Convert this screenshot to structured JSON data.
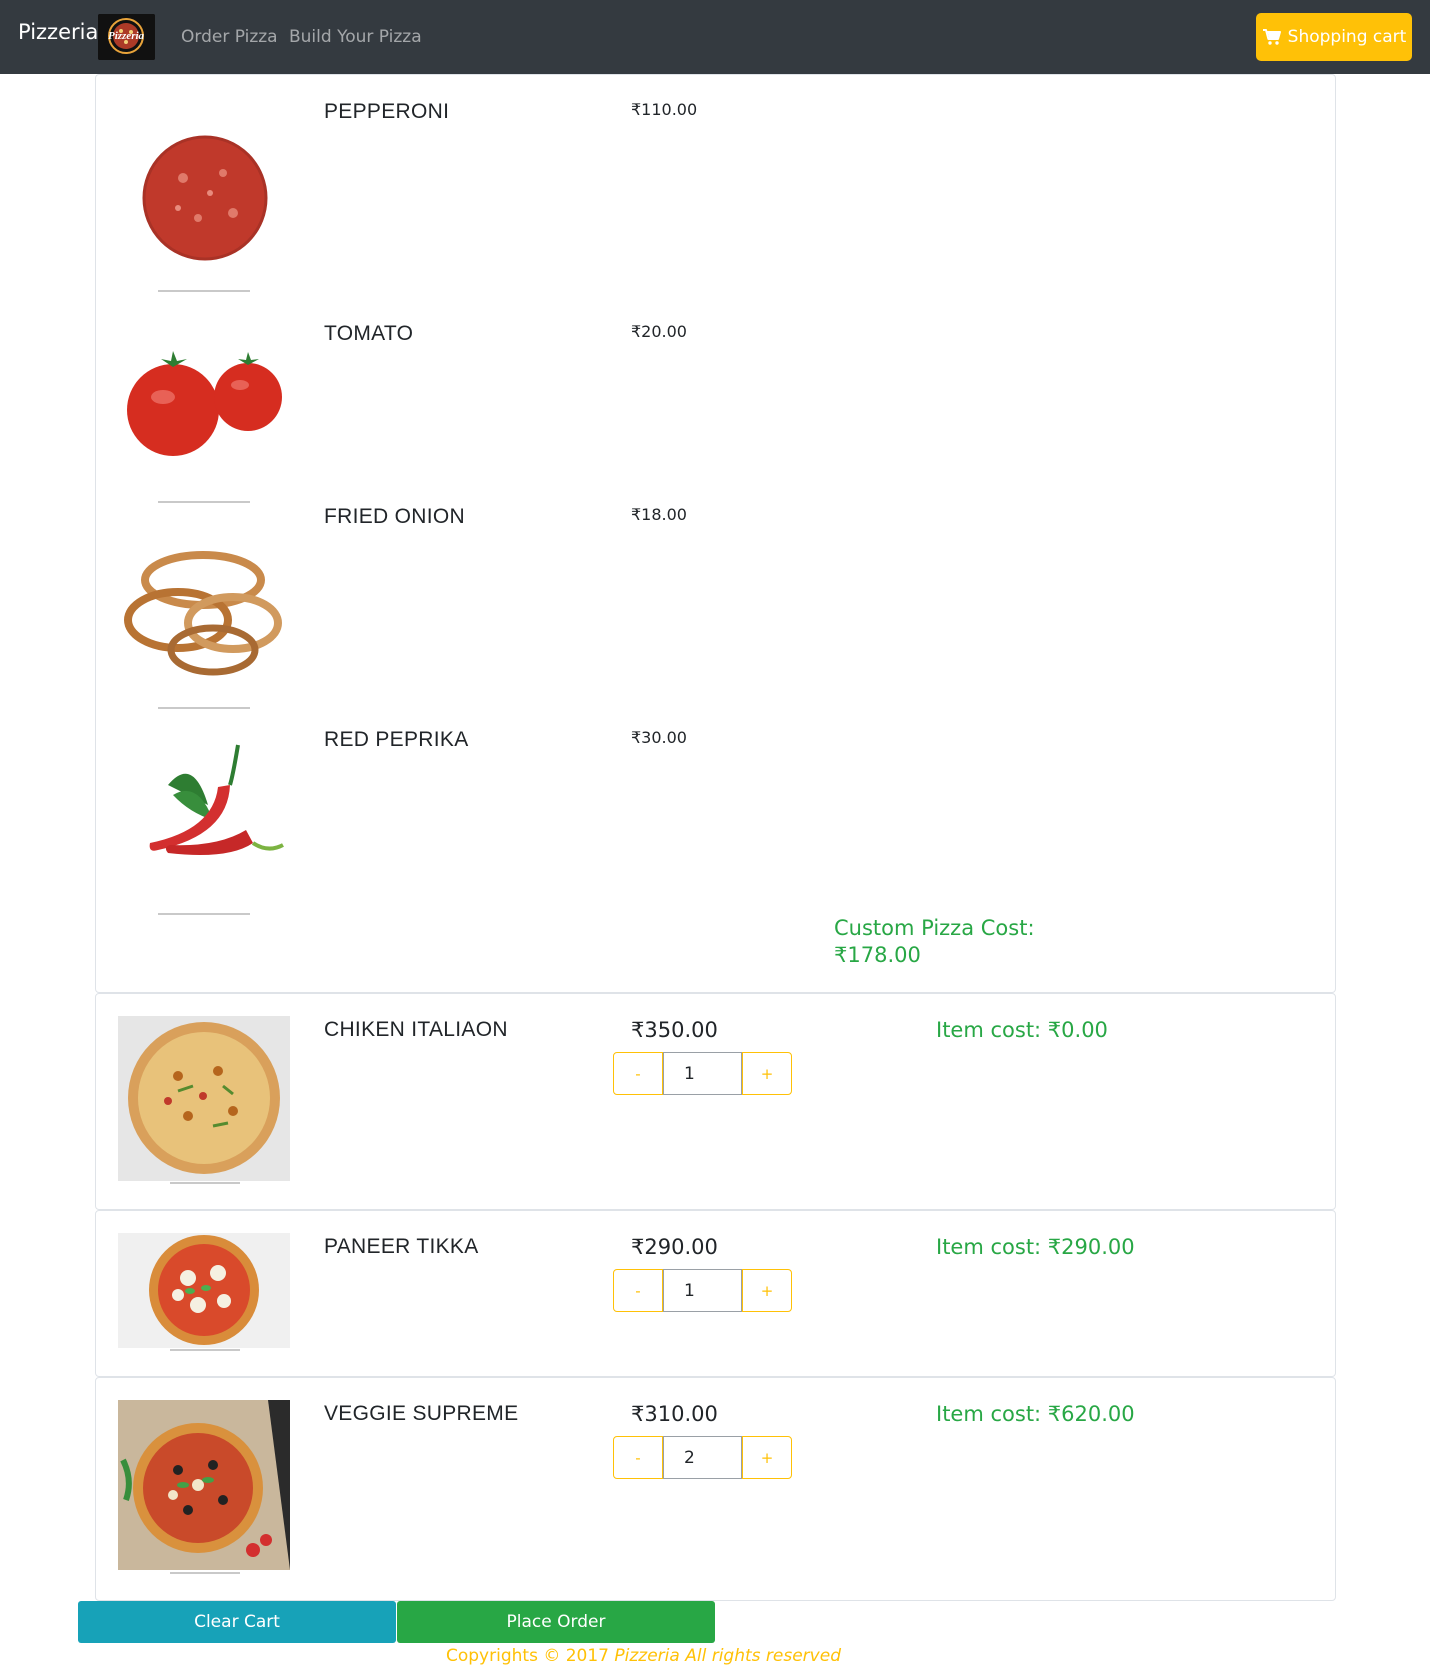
{
  "navbar": {
    "brand": "Pizzeria",
    "logo_text": "Pizzeria",
    "links": [
      "Order Pizza",
      "Build Your Pizza"
    ],
    "cart_label": "Shopping cart",
    "cart_icon": "shopping-cart-icon"
  },
  "custom_pizza": {
    "toppings": [
      {
        "name": "PEPPERONI",
        "price": "₹110.00"
      },
      {
        "name": "TOMATO",
        "price": "₹20.00"
      },
      {
        "name": "FRIED ONION",
        "price": "₹18.00"
      },
      {
        "name": "RED PEPRIKA",
        "price": "₹30.00"
      }
    ],
    "cost_label": "Custom Pizza Cost:",
    "cost_value": "₹178.00"
  },
  "pizzas": [
    {
      "name": "CHIKEN ITALIAON",
      "price": "₹350.00",
      "quantity": "1",
      "item_cost": "Item cost: ₹0.00"
    },
    {
      "name": "PANEER TIKKA",
      "price": "₹290.00",
      "quantity": "1",
      "item_cost": "Item cost: ₹290.00"
    },
    {
      "name": "VEGGIE SUPREME",
      "price": "₹310.00",
      "quantity": "2",
      "item_cost": "Item cost: ₹620.00"
    }
  ],
  "qty_controls": {
    "minus": "-",
    "plus": "+"
  },
  "actions": {
    "clear": "Clear Cart",
    "order": "Place Order"
  },
  "footer": {
    "prefix": "Copyrights © 2017",
    "brand": "Pizzeria",
    "suffix": "All rights reserved"
  },
  "colors": {
    "navbar": "#343a40",
    "warning": "#ffc107",
    "success": "#28a745",
    "info": "#17a2b8"
  }
}
